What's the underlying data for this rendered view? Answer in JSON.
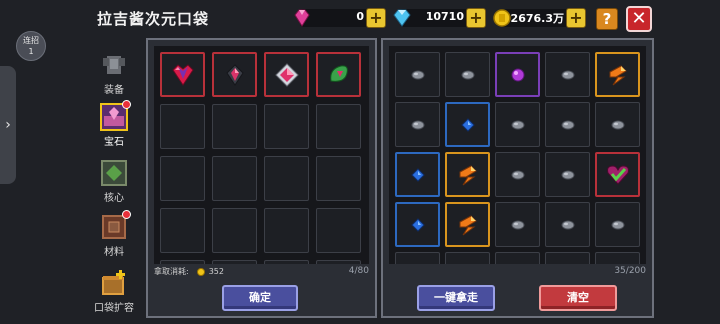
{
  "header": {
    "title": "拉吉酱次元口袋"
  },
  "currencies": [
    {
      "name": "pink-gem",
      "value": "0",
      "color": "#e0409a"
    },
    {
      "name": "diamond",
      "value": "10710",
      "color": "#4ec3f0"
    },
    {
      "name": "gold-coin",
      "value": "2676.3万",
      "color": "#f0c419"
    }
  ],
  "combo": {
    "label_line1": "连招",
    "label_line2": "1"
  },
  "categories": [
    {
      "label": "装备",
      "icon": "armor-icon",
      "active": false,
      "badge": false
    },
    {
      "label": "宝石",
      "icon": "gem-chest-icon",
      "active": true,
      "badge": true
    },
    {
      "label": "核心",
      "icon": "core-icon",
      "active": false,
      "badge": false
    },
    {
      "label": "材料",
      "icon": "material-box-icon",
      "active": false,
      "badge": true
    },
    {
      "label": "口袋扩容",
      "icon": "pocket-expand-icon",
      "active": false,
      "badge": false
    }
  ],
  "left_panel": {
    "rows": [
      [
        "red-heart-gem",
        "dark-shard-gem",
        "rose-gem",
        "green-leaf-gem"
      ],
      [
        "",
        "",
        "",
        ""
      ],
      [
        "",
        "",
        "",
        ""
      ],
      [
        "",
        "",
        "",
        ""
      ],
      [
        "",
        "",
        "",
        ""
      ]
    ],
    "cost_label": "拿取消耗:",
    "cost_value": "352",
    "capacity": "4/80",
    "confirm_label": "确定"
  },
  "right_panel": {
    "rows": [
      [
        "grey-stone",
        "grey-stone",
        "purple-orb",
        "grey-stone",
        "orange-crystal"
      ],
      [
        "grey-stone",
        "blue-diamond",
        "grey-stone",
        "grey-stone",
        "grey-stone"
      ],
      [
        "blue-diamond",
        "orange-crystal",
        "grey-stone",
        "grey-stone",
        "heart-check-gem"
      ],
      [
        "blue-diamond",
        "orange-crystal",
        "grey-stone",
        "grey-stone",
        "grey-stone"
      ],
      [
        "",
        "",
        "",
        "",
        ""
      ]
    ],
    "capacity": "35/200",
    "take_all_label": "一键拿走",
    "clear_label": "清空"
  },
  "colors": {
    "accent_gold": "#e9c630",
    "close_red": "#c8262b",
    "help_orange": "#d9881f"
  }
}
